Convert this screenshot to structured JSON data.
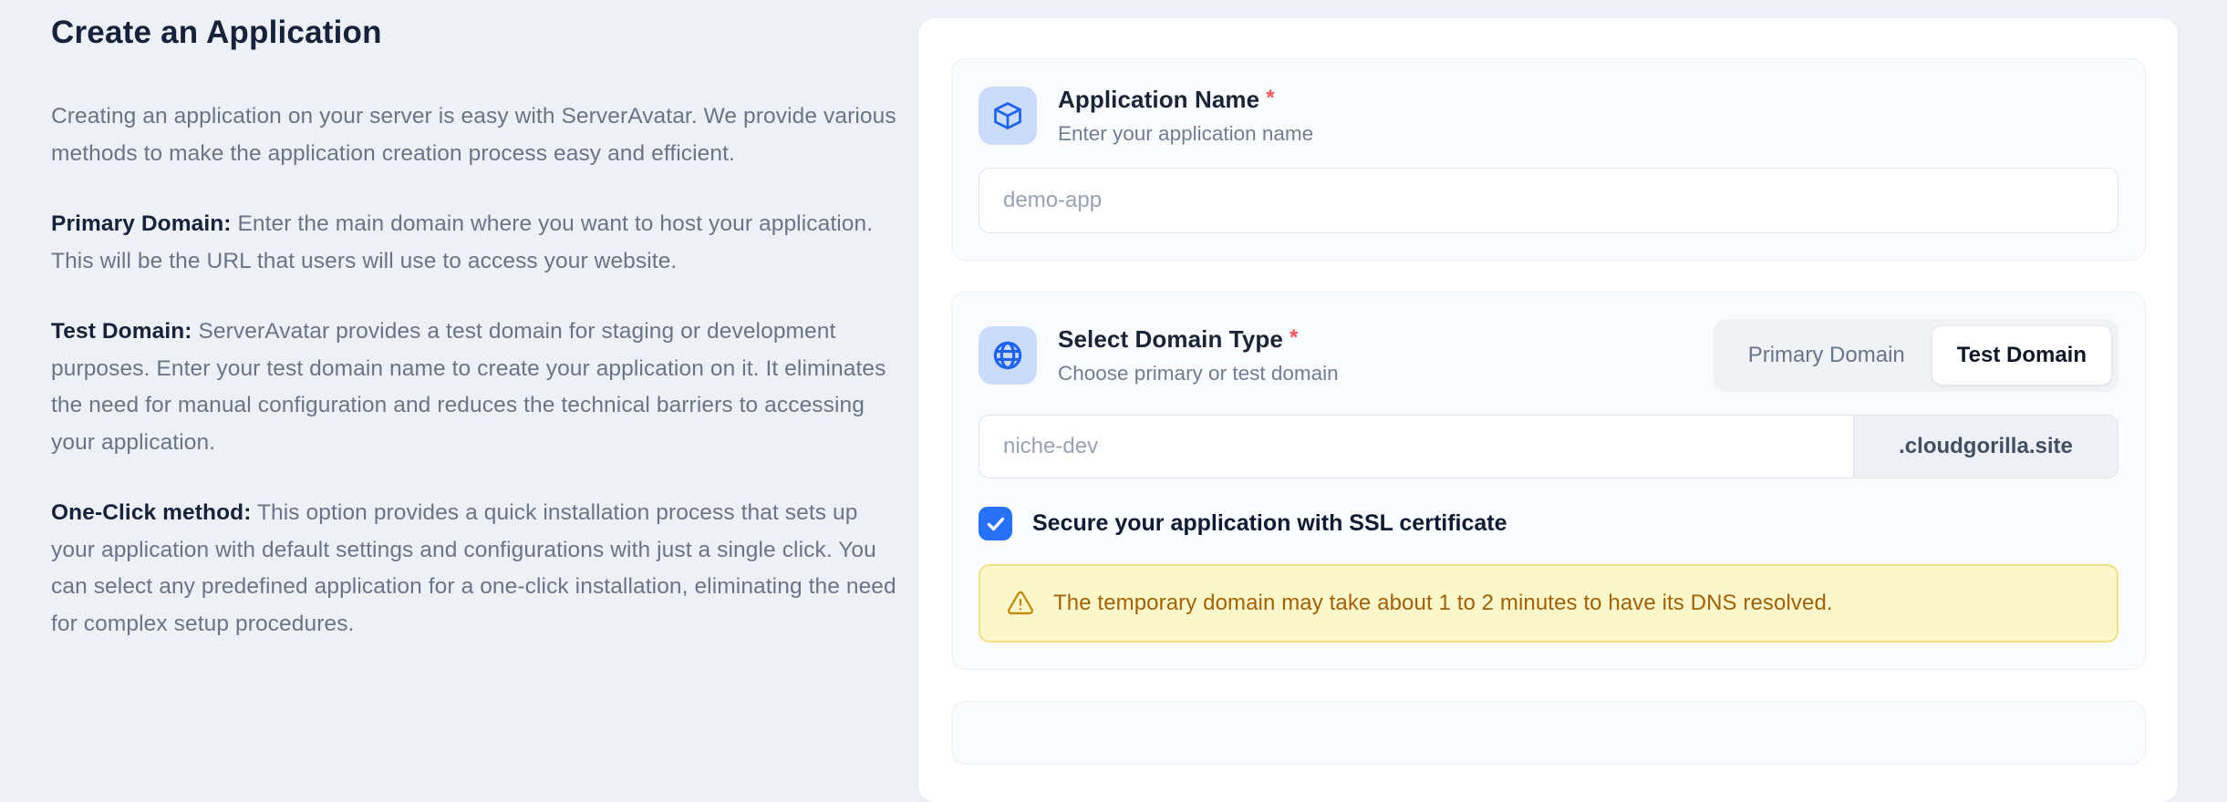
{
  "info": {
    "title": "Create an Application",
    "intro": "Creating an application on your server is easy with ServerAvatar. We provide various methods to make the application creation process easy and efficient.",
    "paragraphs": [
      {
        "label": "Primary Domain:",
        "text": " Enter the main domain where you want to host your application. This will be the URL that users will use to access your website."
      },
      {
        "label": "Test Domain:",
        "text": " ServerAvatar provides a test domain for staging or development purposes. Enter your test domain name to create your application on it. It eliminates the need for manual configuration and reduces the technical barriers to accessing your application."
      },
      {
        "label": "One-Click method:",
        "text": " This option provides a quick installation process that sets up your application with default settings and configurations with just a single click. You can select any predefined application for a one-click installation, eliminating the need for complex setup procedures."
      }
    ]
  },
  "form": {
    "required_mark": "*",
    "app_name": {
      "icon": "cube-icon",
      "title": "Application Name",
      "subtitle": "Enter your application name",
      "value": "",
      "placeholder": "demo-app"
    },
    "domain": {
      "icon": "globe-icon",
      "title": "Select Domain Type",
      "subtitle": "Choose primary or test domain",
      "toggle": {
        "options": [
          "Primary Domain",
          "Test Domain"
        ],
        "active": "Test Domain"
      },
      "value": "",
      "placeholder": "niche-dev",
      "suffix": ".cloudgorilla.site",
      "ssl_label": "Secure your application with SSL certificate",
      "ssl_checked": true,
      "warning_icon": "warning-triangle-icon",
      "warning": "The temporary domain may take about 1 to 2 minutes to have its DNS resolved."
    }
  },
  "colors": {
    "page_background": "#edf1f6",
    "panel_background": "#ffffff",
    "accent_blue": "#1f62ee",
    "icon_tile_blue": "#cbdcfb",
    "checkbox_blue": "#2671f5",
    "required_red": "#f25757",
    "warning_background": "#fcf6cb",
    "warning_border": "#f0e085",
    "warning_text": "#a16207"
  }
}
